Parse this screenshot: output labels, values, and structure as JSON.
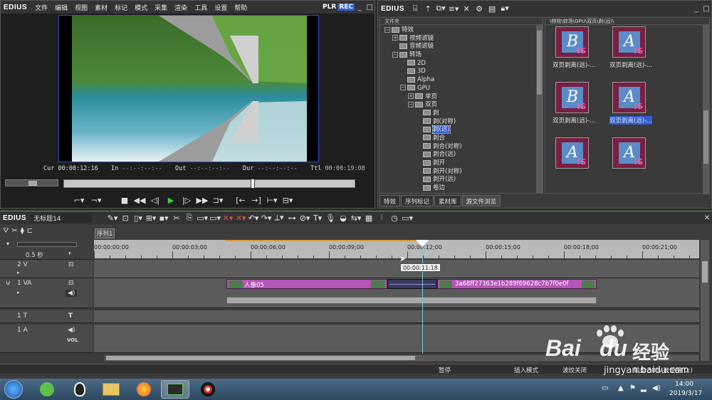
{
  "app": {
    "name": "EDIUS"
  },
  "menu": [
    "文件",
    "编辑",
    "视图",
    "素材",
    "标记",
    "模式",
    "采集",
    "渲染",
    "工具",
    "设置",
    "帮助"
  ],
  "player": {
    "plr_label": "PLR",
    "rec_label": "REC",
    "cur_label": "Cur",
    "cur_value": "00:00:12:16",
    "in_label": "In",
    "in_value": "--:--:--:--",
    "out_label": "Out",
    "out_value": "--:--:--:--",
    "dur_label": "Dur",
    "dur_value": "--:--:--:--",
    "ttl_label": "Ttl",
    "ttl_value": "00:00:19:08"
  },
  "effects": {
    "logo": "EDIUS",
    "tree_header": "文件夹",
    "path": "\\特效\\转场\\GPU\\双页\\剥(远)\\",
    "tree": [
      {
        "label": "特效",
        "indent": 0,
        "exp": "−"
      },
      {
        "label": "视频滤镜",
        "indent": 1,
        "exp": "+"
      },
      {
        "label": "音频滤镜",
        "indent": 1,
        "exp": ""
      },
      {
        "label": "转场",
        "indent": 1,
        "exp": "−"
      },
      {
        "label": "2D",
        "indent": 2,
        "exp": ""
      },
      {
        "label": "3D",
        "indent": 2,
        "exp": ""
      },
      {
        "label": "Alpha",
        "indent": 2,
        "exp": ""
      },
      {
        "label": "GPU",
        "indent": 2,
        "exp": "−"
      },
      {
        "label": "单页",
        "indent": 3,
        "exp": "+"
      },
      {
        "label": "双页",
        "indent": 3,
        "exp": "−"
      },
      {
        "label": "剥",
        "indent": 4,
        "exp": ""
      },
      {
        "label": "剥(对称)",
        "indent": 4,
        "exp": ""
      },
      {
        "label": "剥(远)",
        "indent": 4,
        "exp": "",
        "selected": true
      },
      {
        "label": "剥合",
        "indent": 4,
        "exp": ""
      },
      {
        "label": "剥合(对称)",
        "indent": 4,
        "exp": ""
      },
      {
        "label": "剥合(远)",
        "indent": 4,
        "exp": ""
      },
      {
        "label": "剥开",
        "indent": 4,
        "exp": ""
      },
      {
        "label": "剥开(对称)",
        "indent": 4,
        "exp": ""
      },
      {
        "label": "剥开(远)",
        "indent": 4,
        "exp": ""
      },
      {
        "label": "卷边",
        "indent": 4,
        "exp": ""
      }
    ],
    "thumbs": [
      {
        "letter": "B",
        "label": "双页剥离(远)-..."
      },
      {
        "letter": "A",
        "label": "双页剥离(远)-..."
      },
      {
        "letter": "B",
        "label": "双页剥离(远)-..."
      },
      {
        "letter": "A",
        "label": "双页剥离(远)-...",
        "selected": true
      },
      {
        "letter": "A",
        "label": ""
      },
      {
        "letter": "A",
        "label": ""
      }
    ],
    "tabs": [
      "特效",
      "序列标记",
      "素材库",
      "源文件浏览"
    ]
  },
  "timeline": {
    "logo": "EDIUS",
    "project_name": "无标题14",
    "sequence_tab": "序列1",
    "scale_label": "0.5 秒",
    "ruler": [
      "00:00:00;00",
      "00:00:03;00",
      "00:00:06;00",
      "00:00:09;00",
      "00:00:12;00",
      "00:00:15;00",
      "00:00:18;00",
      "00:00:21;00"
    ],
    "cursor_tooltip": "00:00:11:18",
    "tracks": [
      {
        "name": "2 V"
      },
      {
        "name": "1 VA"
      },
      {
        "name": "1 T"
      },
      {
        "name": "1 A",
        "vol": "VOL"
      }
    ],
    "clip1_label": "人像05",
    "clip2_label": "3a68ff27363e1b289f69628c7b7f0e0f"
  },
  "status": {
    "pause": "暂停",
    "insert_mode": "插入模式",
    "ripple": "波纹关闭",
    "disk": "磁盘:58% 被使用(D:)"
  },
  "taskbar": {
    "time": "14:00",
    "date": "2019/3/17"
  },
  "watermark": {
    "brand": "Bai",
    "brand2": "du",
    "cn": "经验",
    "url": "jingyan.baidu.com"
  }
}
